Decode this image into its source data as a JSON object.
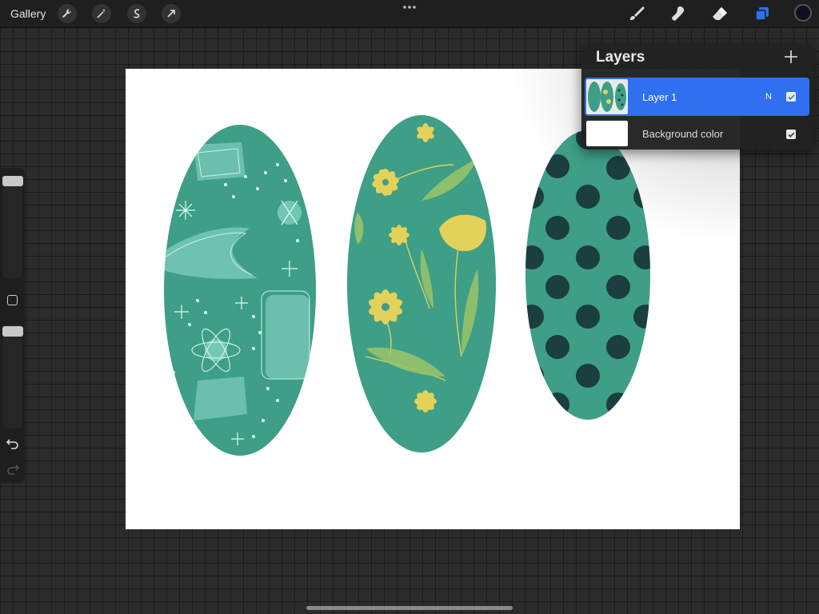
{
  "toolbar": {
    "gallery_label": "Gallery",
    "left_tools": [
      "wrench-icon",
      "magic-wand-icon",
      "selection-icon",
      "transform-arrow-icon"
    ],
    "right_tools": [
      "brush-icon",
      "smudge-icon",
      "eraser-icon",
      "layers-icon"
    ],
    "current_color": "#0d1020",
    "active_tool_color": "#2f6ff0"
  },
  "layers_panel": {
    "title": "Layers",
    "layers": [
      {
        "name": "Layer 1",
        "blend_mode": "N",
        "visible": true,
        "selected": true
      },
      {
        "name": "Background color",
        "visible": true,
        "selected": false
      }
    ]
  },
  "canvas": {
    "background": "#ffffff",
    "shapes": [
      {
        "pattern": "atomic-retro",
        "fill": "#3e9e86",
        "accent": "#9fe6d4"
      },
      {
        "pattern": "yellow-florals",
        "fill": "#3e9e86",
        "accent": "#e3d25a"
      },
      {
        "pattern": "polka-dots",
        "fill": "#3e9e86",
        "accent": "#1b3e3e"
      }
    ]
  }
}
